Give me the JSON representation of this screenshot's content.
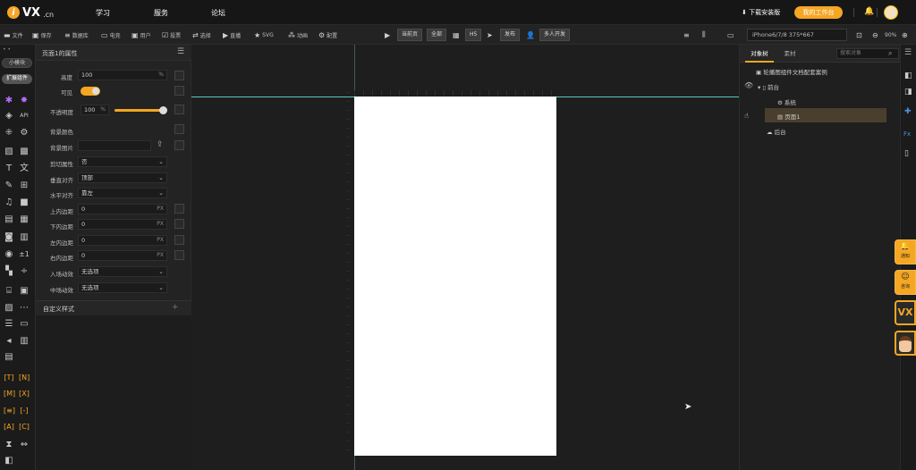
{
  "topnav": {
    "logo": "VX",
    "logo_suffix": ".cn",
    "links": [
      "学习",
      "服务",
      "论坛"
    ],
    "download": "下载安装版",
    "workspace": "我的工作台"
  },
  "toolbar": {
    "items": [
      "文件",
      "保存",
      "数据库",
      "电竞",
      "用户",
      "投票",
      "选择",
      "直播",
      "SVG",
      "动画",
      "配置"
    ],
    "page_btn": "当前页",
    "all_btn": "全部",
    "h5": "H5",
    "publish": "发布",
    "collab": "多人开发",
    "device": "iPhone6/7/8 375*667",
    "zoom": "90%"
  },
  "rail": {
    "tab1": "小模块",
    "tab2": "扩展组件",
    "api": "API",
    "pm1": "±1"
  },
  "props": {
    "title": "页面1的属性",
    "height_label": "高度",
    "height_value": "100",
    "height_unit": "%",
    "visible_label": "可见",
    "opacity_label": "不透明度",
    "opacity_value": "100",
    "opacity_unit": "%",
    "opacity_fraction": 1.0,
    "bgcolor_label": "背景颜色",
    "bgimage_label": "背景图片",
    "clip_label": "剪切属性",
    "clip_value": "否",
    "valign_label": "垂直对齐",
    "valign_value": "顶部",
    "halign_label": "水平对齐",
    "halign_value": "靠左",
    "pad_top_label": "上内边距",
    "pad_top_value": "0",
    "pad_bottom_label": "下内边距",
    "pad_bottom_value": "0",
    "pad_left_label": "左内边距",
    "pad_left_value": "0",
    "pad_right_label": "右内边距",
    "pad_right_value": "0",
    "px": "PX",
    "enter_anim_label": "入场动效",
    "enter_anim_value": "无选项",
    "mid_anim_label": "中场动效",
    "mid_anim_value": "无选项",
    "custom_style": "自定义样式"
  },
  "rpanel": {
    "tab_objects": "对象树",
    "tab_assets": "素材",
    "search_placeholder": "搜索对象",
    "tree": {
      "root": "轮播图组件文档配套案例",
      "front": "前台",
      "system": "系统",
      "page": "页面1",
      "back": "后台"
    }
  },
  "frail": {
    "notify": "通知",
    "consult": "咨询",
    "vx": "VX"
  },
  "colors": {
    "accent": "#f5a623",
    "canvas_page": "#ffffff",
    "guide": "#5ec7c7"
  }
}
